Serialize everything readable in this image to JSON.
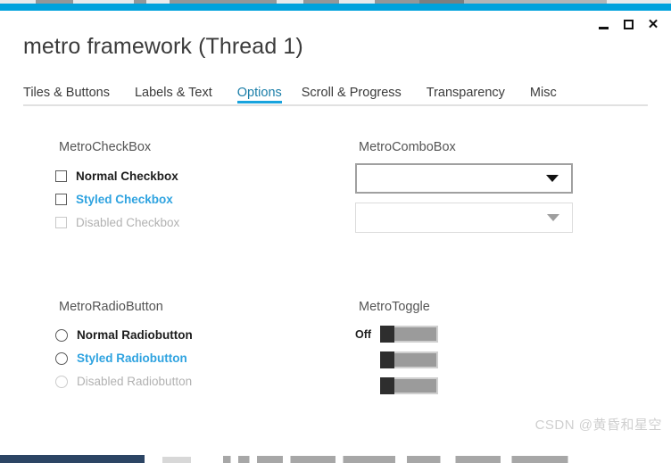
{
  "window": {
    "title": "metro framework (Thread 1)",
    "accent_color": "#00a2dd",
    "controls": {
      "minimize_label": "–",
      "maximize_label": "□",
      "close_label": "✕"
    }
  },
  "tabs": [
    {
      "label": "Tiles & Buttons",
      "active": false
    },
    {
      "label": "Labels & Text",
      "active": false
    },
    {
      "label": "Options",
      "active": true
    },
    {
      "label": "Scroll & Progress",
      "active": false
    },
    {
      "label": "Transparency",
      "active": false
    },
    {
      "label": "Misc",
      "active": false
    }
  ],
  "groups": {
    "checkbox": {
      "title": "MetroCheckBox",
      "items": [
        {
          "label": "Normal Checkbox",
          "state": "normal",
          "checked": false
        },
        {
          "label": "Styled Checkbox",
          "state": "styled",
          "checked": false
        },
        {
          "label": "Disabled Checkbox",
          "state": "disabled",
          "checked": false
        }
      ]
    },
    "combobox": {
      "title": "MetroComboBox",
      "items": [
        {
          "value": "",
          "state": "normal"
        },
        {
          "value": "",
          "state": "disabled"
        }
      ]
    },
    "radiobutton": {
      "title": "MetroRadioButton",
      "items": [
        {
          "label": "Normal Radiobutton",
          "state": "normal",
          "selected": false
        },
        {
          "label": "Styled Radiobutton",
          "state": "styled",
          "selected": false
        },
        {
          "label": "Disabled Radiobutton",
          "state": "disabled",
          "selected": false
        }
      ]
    },
    "toggle": {
      "title": "MetroToggle",
      "items": [
        {
          "label": "Off",
          "on": false
        },
        {
          "label": "",
          "on": false
        },
        {
          "label": "",
          "on": false
        }
      ]
    }
  },
  "watermark": {
    "text": "CSDN @黄昏和星空"
  },
  "colors": {
    "accent": "#00a2dd",
    "styled_text": "#2fa3e0",
    "disabled_text": "#b2b2b2",
    "normal_text": "#1c1c1c",
    "group_title": "#555555"
  }
}
